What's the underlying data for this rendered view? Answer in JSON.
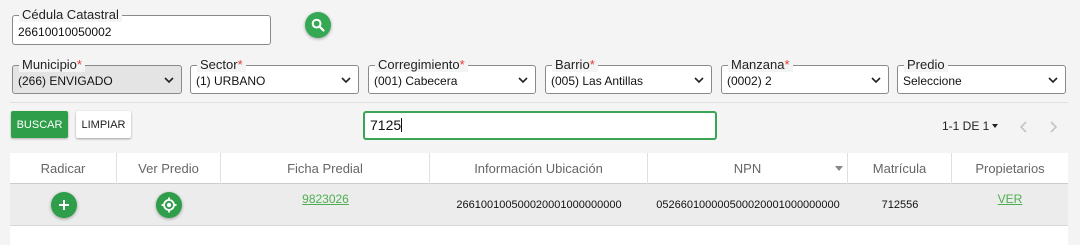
{
  "cedula": {
    "label": "Cédula Catastral",
    "value": "26610010050002"
  },
  "filters": [
    {
      "key": "municipio",
      "label": "Municipio",
      "required": "*",
      "value": "(266) ENVIGADO",
      "disabled": true
    },
    {
      "key": "sector",
      "label": "Sector",
      "required": "*",
      "value": "(1) URBANO"
    },
    {
      "key": "corregimiento",
      "label": "Corregimiento",
      "required": "*",
      "value": "(001) Cabecera"
    },
    {
      "key": "barrio",
      "label": "Barrio",
      "required": "*",
      "value": "(005) Las Antillas"
    },
    {
      "key": "manzana",
      "label": "Manzana",
      "required": "*",
      "value": "(0002) 2"
    },
    {
      "key": "predio",
      "label": "Predio",
      "required": "",
      "value": "Seleccione"
    }
  ],
  "actions": {
    "buscar": "BUSCAR",
    "limpiar": "LIMPIAR"
  },
  "table_filter": {
    "value": "7125"
  },
  "pagination": {
    "range": "1-1 DE 1"
  },
  "table": {
    "columns": [
      "Radicar",
      "Ver Predio",
      "Ficha Predial",
      "Información Ubicación",
      "NPN",
      "Matrícula",
      "Propietarios"
    ],
    "rows": [
      {
        "ficha_predial": "9823026",
        "informacion_ubicacion": "266100100500020001000000000",
        "npn": "052660100000500020001000000000",
        "matricula": "712556",
        "propietarios": "VER"
      }
    ]
  },
  "colors": {
    "primary_green": "#2e9e4a",
    "link_green": "#4caf50",
    "required_red": "#e53935"
  },
  "icons": {
    "search": "search-icon",
    "dropdown": "chevron-down-icon",
    "radicar": "plus-icon",
    "ver_predio": "target-locate-icon",
    "prev": "chevron-left-icon",
    "next": "chevron-right-icon"
  }
}
